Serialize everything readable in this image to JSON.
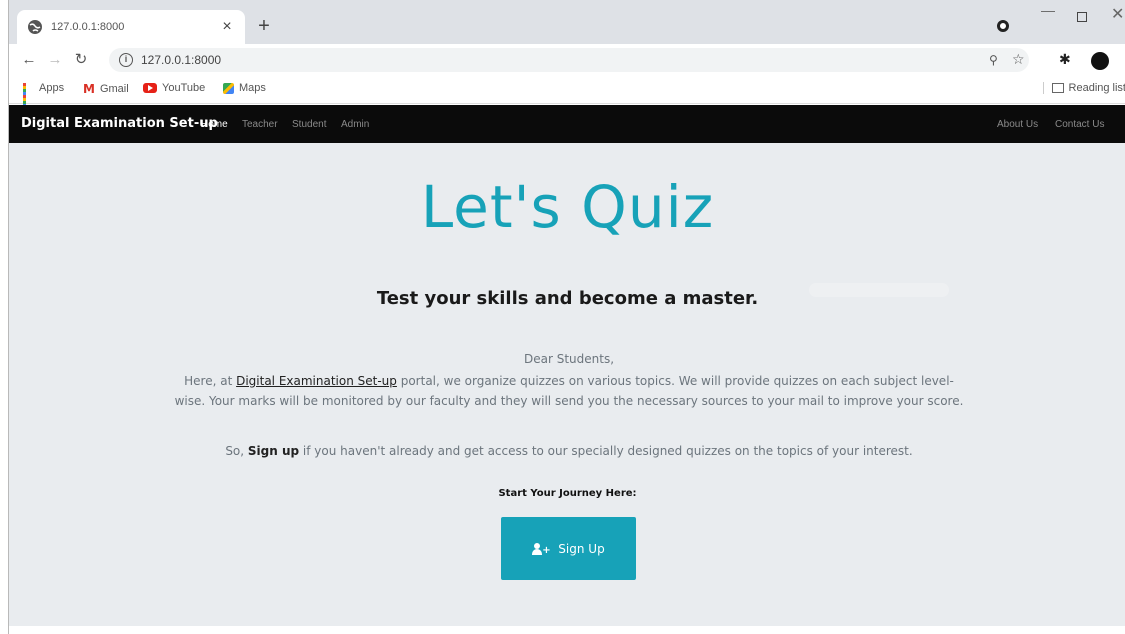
{
  "browser": {
    "tab_title": "127.0.0.1:8000",
    "tab_close": "×",
    "new_tab": "+",
    "url": "127.0.0.1:8000",
    "bookmarks": [
      {
        "label": "Apps",
        "icon": "apps-grid-icon"
      },
      {
        "label": "Gmail",
        "icon": "gmail-icon"
      },
      {
        "label": "YouTube",
        "icon": "youtube-icon"
      },
      {
        "label": "Maps",
        "icon": "maps-icon"
      }
    ],
    "reading_list": "Reading list"
  },
  "navbar": {
    "brand": "Digital Examination Set-up",
    "links": [
      "Home",
      "Teacher",
      "Student",
      "Admin"
    ],
    "active": "Home",
    "right_links": [
      "About Us",
      "Contact Us"
    ],
    "bg_color": "#0b0b0b"
  },
  "hero": {
    "title": "Let's Quiz",
    "tagline": "Test your skills and become a master.",
    "greeting": "Dear Students,",
    "body1_prefix": "Here, at ",
    "body1_link": "Digital Examination Set-up",
    "body1_suffix": " portal, we organize quizzes on various topics. We will provide quizzes on each subject level-wise. Your marks will be monitored by our faculty and they will send you the necessary sources to your mail to improve your score.",
    "body2_prefix": "So, ",
    "body2_bold": "Sign up",
    "body2_suffix": " if you haven't already and get access to our specially designed quizzes on the topics of your interest.",
    "start_label": "Start Your Journey Here:",
    "signup_label": "Sign Up",
    "accent_color": "#17a2b8"
  }
}
